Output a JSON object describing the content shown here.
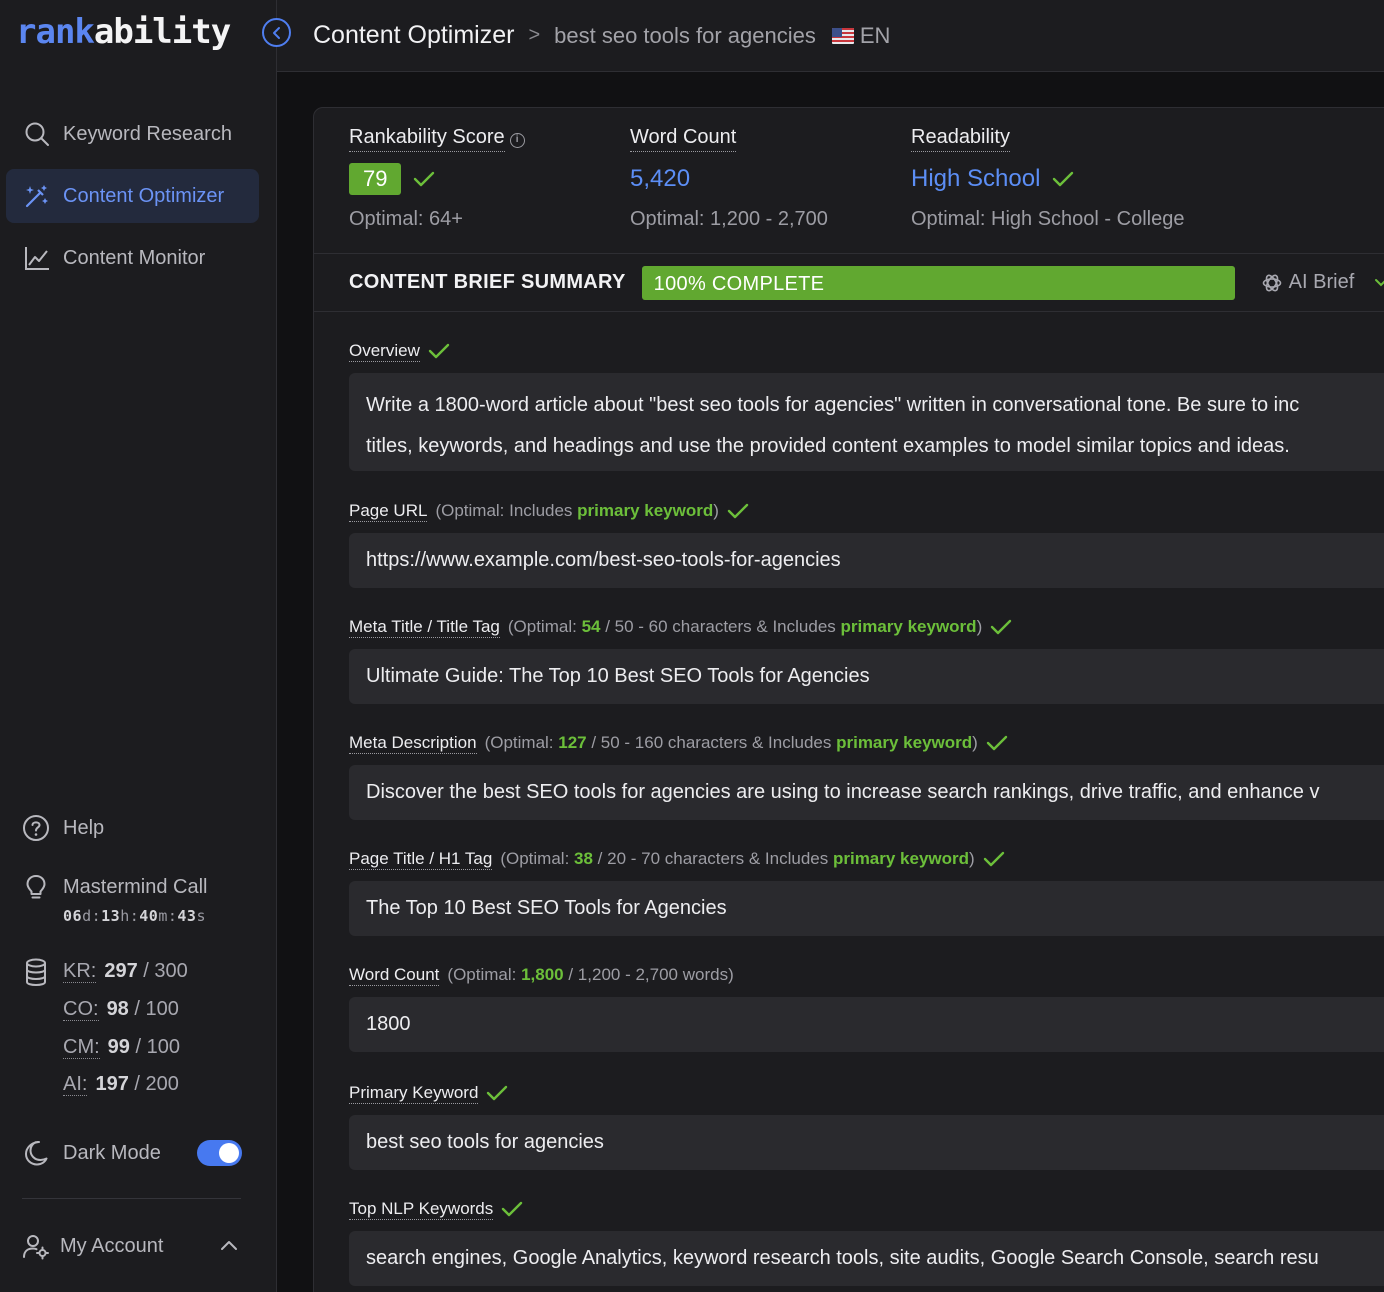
{
  "logo": {
    "part1": "rank",
    "part2": "ability"
  },
  "sidebar": {
    "nav": [
      {
        "label": "Keyword Research",
        "icon": "search-icon",
        "active": false
      },
      {
        "label": "Content Optimizer",
        "icon": "magic-wand-icon",
        "active": true
      },
      {
        "label": "Content Monitor",
        "icon": "line-chart-icon",
        "active": false
      }
    ],
    "help": "Help",
    "mastermind": {
      "label": "Mastermind Call",
      "countdown": {
        "d": "06",
        "h": "13",
        "m": "40",
        "s": "43"
      }
    },
    "credits": [
      {
        "key": "KR:",
        "used": "297",
        "total": "/ 300"
      },
      {
        "key": "CO:",
        "used": "98",
        "total": "/ 100"
      },
      {
        "key": "CM:",
        "used": "99",
        "total": "/ 100"
      },
      {
        "key": "AI:",
        "used": "197",
        "total": "/ 200"
      }
    ],
    "dark_mode": {
      "label": "Dark Mode",
      "enabled": true
    },
    "account": "My Account"
  },
  "header": {
    "title": "Content Optimizer",
    "separator": ">",
    "keyword": "best seo tools for agencies",
    "language": "EN"
  },
  "metrics": {
    "score": {
      "label": "Rankability Score",
      "value": "79",
      "optimal": "Optimal: 64+"
    },
    "word_count": {
      "label": "Word Count",
      "value": "5,420",
      "optimal": "Optimal: 1,200 - 2,700"
    },
    "readability": {
      "label": "Readability",
      "value": "High School",
      "optimal": "Optimal: High School - College"
    }
  },
  "brief": {
    "title": "CONTENT BRIEF SUMMARY",
    "progress_text": "100% COMPLETE",
    "progress": 1.0,
    "ai_brief": "AI Brief"
  },
  "fields": {
    "overview": {
      "label": "Overview",
      "line1": "Write a 1800-word article about \"best seo tools for agencies\" written in conversational tone. Be sure to inc",
      "line2": "titles, keywords, and headings and use the provided content examples to model similar topics and ideas."
    },
    "page_url": {
      "label": "Page URL",
      "hint_pre": "(Optimal: Includes ",
      "hint_kw": "primary keyword",
      "hint_post": ")",
      "value": "https://www.example.com/best-seo-tools-for-agencies"
    },
    "meta_title": {
      "label": "Meta Title / Title Tag",
      "hint_pre": "(Optimal: ",
      "count": "54",
      "hint_mid": " / 50 - 60 characters & Includes ",
      "hint_kw": "primary keyword",
      "hint_post": ")",
      "value": "Ultimate Guide: The Top 10 Best SEO Tools for Agencies"
    },
    "meta_description": {
      "label": "Meta Description",
      "hint_pre": "(Optimal: ",
      "count": "127",
      "hint_mid": " / 50 - 160 characters & Includes ",
      "hint_kw": "primary keyword",
      "hint_post": ")",
      "value": "Discover the best SEO tools for agencies are using to increase search rankings, drive traffic, and enhance v"
    },
    "page_title": {
      "label": "Page Title / H1 Tag",
      "hint_pre": "(Optimal: ",
      "count": "38",
      "hint_mid": " / 20 - 70 characters & Includes ",
      "hint_kw": "primary keyword",
      "hint_post": ")",
      "value": "The Top 10 Best SEO Tools for Agencies"
    },
    "word_count": {
      "label": "Word Count",
      "hint_pre": "(Optimal: ",
      "count": "1,800",
      "hint_post": " / 1,200 - 2,700 words)",
      "value": "1800"
    },
    "primary_keyword": {
      "label": "Primary Keyword",
      "value": "best seo tools for agencies"
    },
    "nlp_keywords": {
      "label": "Top NLP Keywords",
      "value": "search engines, Google Analytics, keyword research tools, site audits, Google Search Console, search resu"
    }
  },
  "colors": {
    "accent": "#5b86f0",
    "success": "#61a830",
    "check": "#6cbf3a"
  }
}
